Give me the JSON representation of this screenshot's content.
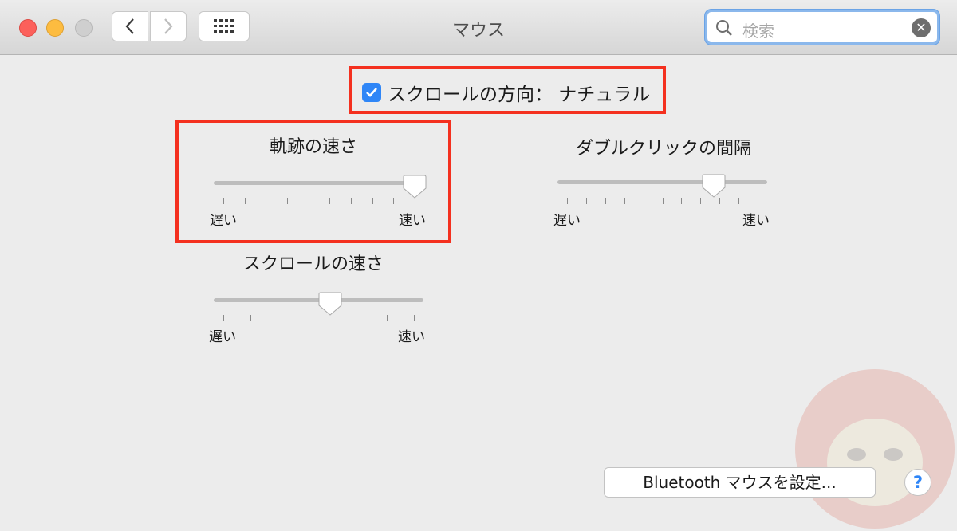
{
  "window": {
    "title": "マウス"
  },
  "toolbar": {
    "back_icon": "chevron-left-icon",
    "forward_icon": "chevron-right-icon",
    "grid_icon": "grid-icon"
  },
  "search": {
    "placeholder": "検索",
    "value": ""
  },
  "scroll_direction": {
    "label": "スクロールの方向： ナチュラル",
    "checked": true
  },
  "tracking_speed": {
    "title": "軌跡の速さ",
    "min_label": "遅い",
    "max_label": "速い",
    "value": 1.0,
    "ticks": 10
  },
  "scroll_speed": {
    "title": "スクロールの速さ",
    "min_label": "遅い",
    "max_label": "速い",
    "value": 0.56,
    "ticks": 8
  },
  "double_click": {
    "title": "ダブルクリックの間隔",
    "min_label": "遅い",
    "max_label": "速い",
    "value": 0.77,
    "ticks": 11
  },
  "bluetooth_button": {
    "label": "Bluetooth マウスを設定..."
  },
  "help_button": {
    "label": "?"
  },
  "colors": {
    "accent": "#2f86f7",
    "highlight": "#f4301f"
  }
}
